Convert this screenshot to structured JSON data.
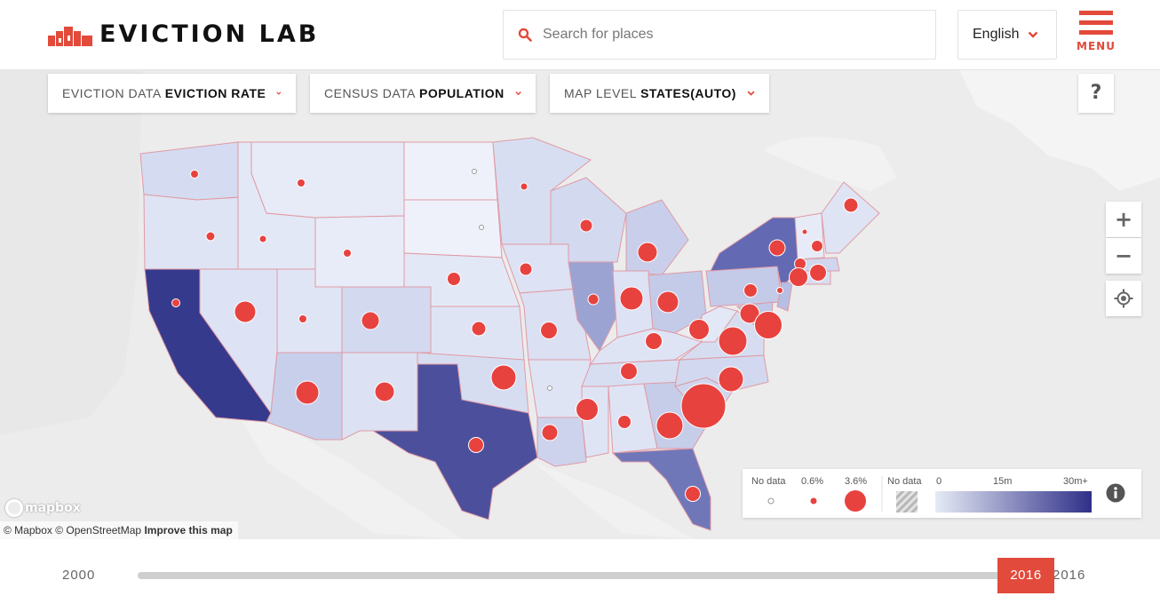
{
  "header": {
    "logo_text": "EVICTION LAB",
    "search_placeholder": "Search for places",
    "language": "English",
    "menu_label": "MENU"
  },
  "controls": {
    "eviction": {
      "label": "EVICTION DATA",
      "value": "EVICTION RATE"
    },
    "census": {
      "label": "CENSUS DATA",
      "value": "POPULATION"
    },
    "level": {
      "label": "MAP LEVEL",
      "value": "STATES(AUTO)"
    },
    "help": "?",
    "zoom_in": "+",
    "zoom_out": "−"
  },
  "legend": {
    "bubble_nodata": "No data",
    "bubble_low": "0.6%",
    "bubble_high": "3.6%",
    "choropleth_nodata": "No data",
    "scale_min": "0",
    "scale_mid": "15m",
    "scale_max": "30m+"
  },
  "attribution": {
    "logo": "mapbox",
    "text": "© Mapbox © OpenStreetMap",
    "improve": "Improve this map"
  },
  "timeline": {
    "start": "2000",
    "end": "2016",
    "current": "2016"
  },
  "colors": {
    "accent": "#e24a3b",
    "bubble": "#e8423f",
    "choropleth_low": "#e6ebf6",
    "choropleth_high": "#2f2f88"
  }
}
